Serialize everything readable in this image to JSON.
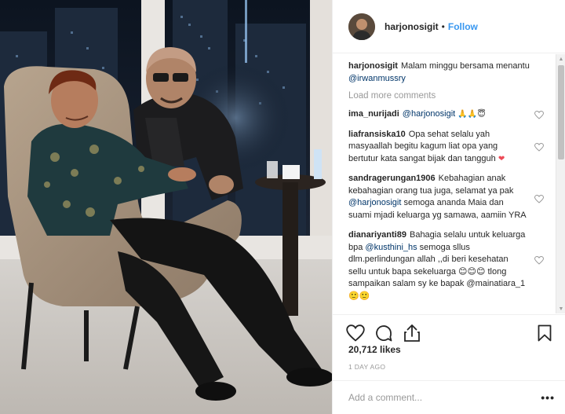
{
  "header": {
    "username": "harjonosigit",
    "separator": "•",
    "follow_label": "Follow"
  },
  "caption": {
    "username": "harjonosigit",
    "text": "Malam minggu bersama menantu ",
    "mention": "@irwanmussry"
  },
  "load_more_label": "Load more comments",
  "comments": [
    {
      "username": "ima_nurijadi",
      "pre": "",
      "mention": "@harjonosigit",
      "post": " 🙏🙏😇"
    },
    {
      "username": "liafransiska10",
      "pre": "Opa sehat selalu yah masyaallah begitu kagum liat opa yang bertutur kata sangat bijak dan tangguh ",
      "mention": "",
      "post": "❤"
    },
    {
      "username": "sandragerungan1906",
      "pre": "Kebahagian anak kebahagian orang tua juga, selamat ya pak ",
      "mention": "@harjonosigit",
      "post": " semoga ananda Maia dan suami mjadi keluarga yg samawa, aamiin YRA"
    },
    {
      "username": "dianariyanti89",
      "pre": "Bahagia selalu untuk keluarga bpa ",
      "mention": "@kusthini_hs",
      "post": " semoga sllus dlm.perlindungan allah ,,di beri kesehatan sellu untuk bapa sekeluarga 😊😊😊 tlong sampaikan salam sy ke bapak @mainatiara_1 🙂🙂"
    }
  ],
  "icons": {
    "like": "heart-icon",
    "comment": "comment-icon",
    "share": "share-icon",
    "save": "bookmark-icon",
    "more": "more-options-icon"
  },
  "likes_text": "20,712 likes",
  "time_text": "1 DAY AGO",
  "add_comment": {
    "placeholder": "Add a comment...",
    "more_label": "•••"
  },
  "colors": {
    "link": "#3897f0",
    "mention": "#003569",
    "muted": "#999999",
    "heart": "#ed4956"
  }
}
